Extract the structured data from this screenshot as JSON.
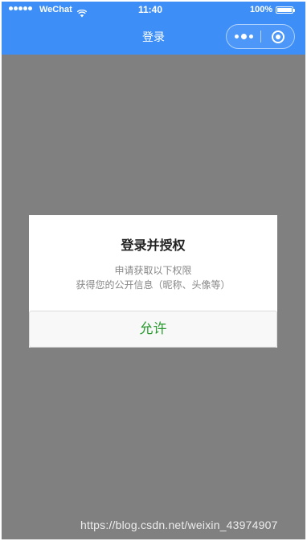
{
  "status_bar": {
    "carrier": "WeChat",
    "time": "11:40",
    "battery": "100%",
    "battery_level": 1.0
  },
  "nav": {
    "title": "登录"
  },
  "modal": {
    "title": "登录并授权",
    "desc_line1": "申请获取以下权限",
    "desc_line2": "获得您的公开信息（昵称、头像等）",
    "button_label": "允许"
  },
  "watermark": "https://blog.csdn.net/weixin_43974907",
  "colors": {
    "nav_bg": "#3d8ff7",
    "overlay_bg": "#808080",
    "accent_green": "#2a9a30"
  }
}
